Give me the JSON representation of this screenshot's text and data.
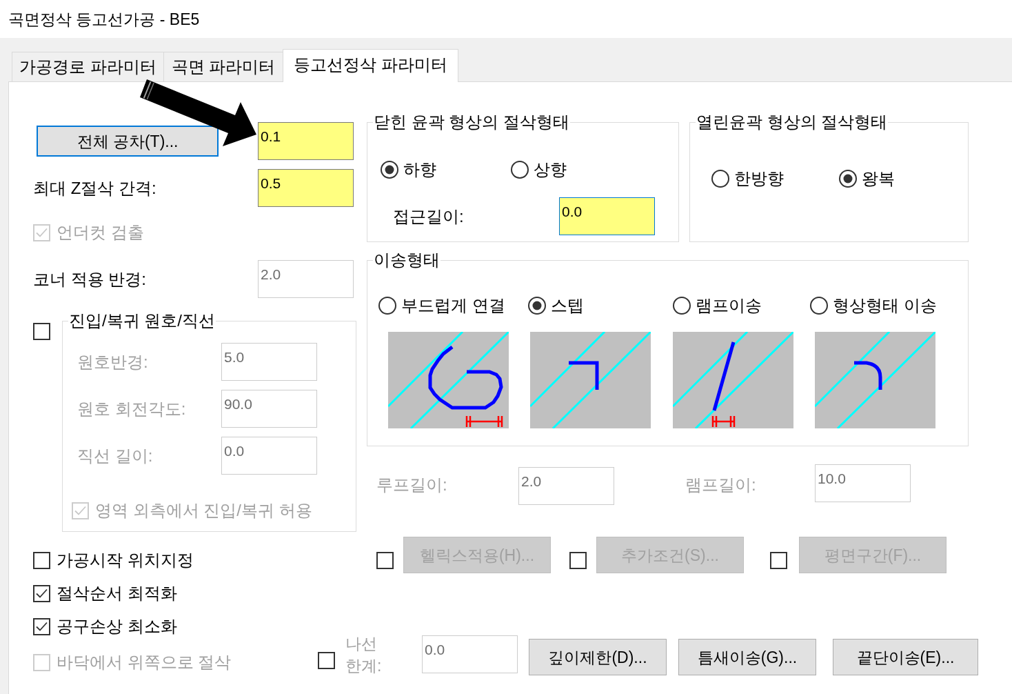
{
  "window": {
    "title": "곡면정삭 등고선가공 - BE5"
  },
  "tabs": [
    {
      "label": "가공경로 파라미터",
      "selected": false
    },
    {
      "label": "곡면 파라미터",
      "selected": false
    },
    {
      "label": "등고선정삭 파라미터",
      "selected": true
    }
  ],
  "tolerance": {
    "button": {
      "label": "전체 공차(T)...",
      "focused": true,
      "disabled": false
    },
    "field": {
      "value": "0.1",
      "highlighted": true
    }
  },
  "max_z_step": {
    "label": "최대 Z절삭 간격:",
    "disabled": false,
    "field": {
      "value": "0.5",
      "highlighted": true
    }
  },
  "undercut_check": {
    "label": "언더컷 검출",
    "checked": true,
    "disabled": true
  },
  "corner_radius": {
    "label": "코너 적용 반경:",
    "disabled": false,
    "field": {
      "value": "2.0",
      "disabled": true
    }
  },
  "entry_exit": {
    "checked": false,
    "title": "진입/복귀 원호/직선",
    "rows": [
      {
        "label": "원호반경:",
        "disabled": true,
        "field": {
          "value": "5.0",
          "disabled": true
        }
      },
      {
        "label": "원호 회전각도:",
        "disabled": true,
        "field": {
          "value": "90.0",
          "disabled": true
        }
      },
      {
        "label": "직선 길이:",
        "disabled": true,
        "field": {
          "value": "0.0",
          "disabled": true
        }
      }
    ],
    "outside_check": {
      "label": "영역 외측에서 진입/복귀 허용",
      "checked": true,
      "disabled": true
    }
  },
  "options": [
    {
      "label": "가공시작 위치지정",
      "checked": false,
      "disabled": false
    },
    {
      "label": "절삭순서 최적화",
      "checked": true,
      "disabled": false
    },
    {
      "label": "공구손상 최소화",
      "checked": true,
      "disabled": false
    }
  ],
  "closed_contour": {
    "title": "닫힌 윤곽 형상의 절삭형태",
    "radios": [
      {
        "label": "하향",
        "selected": true
      },
      {
        "label": "상향",
        "selected": false
      }
    ],
    "approach": {
      "label": "접근길이:",
      "disabled": false,
      "field": {
        "value": "0.0",
        "highlighted": true,
        "focused": true
      }
    }
  },
  "open_contour": {
    "title": "열린윤곽 형상의 절삭형태",
    "radios": [
      {
        "label": "한방향",
        "selected": false
      },
      {
        "label": "왕복",
        "selected": true
      }
    ]
  },
  "link_type": {
    "title": "이송형태",
    "options": [
      {
        "label": "부드럽게 연결",
        "selected": false,
        "kind": "smooth"
      },
      {
        "label": "스텝",
        "selected": true,
        "kind": "step"
      },
      {
        "label": "램프이송",
        "selected": false,
        "kind": "ramp"
      },
      {
        "label": "형상형태 이송",
        "selected": false,
        "kind": "profile"
      }
    ]
  },
  "lengths": [
    {
      "label": "루프길이:",
      "disabled": true,
      "field": {
        "value": "2.0",
        "disabled": true
      }
    },
    {
      "label": "램프길이:",
      "disabled": true,
      "field": {
        "value": "10.0",
        "disabled": true
      }
    }
  ],
  "extras": [
    {
      "checked": false,
      "button": {
        "label": "헬릭스적용(H)...",
        "disabled": true
      }
    },
    {
      "checked": false,
      "button": {
        "label": "추가조건(S)...",
        "disabled": true
      }
    },
    {
      "checked": false,
      "button": {
        "label": "평면구간(F)...",
        "disabled": true
      }
    }
  ],
  "bottom_check": {
    "label": "바닥에서 위쪽으로 절삭",
    "checked": false,
    "disabled": true
  },
  "spiral": {
    "checked": false,
    "label": "나선 한계:",
    "disabled": true,
    "field": {
      "value": "0.0",
      "disabled": true
    }
  },
  "bottom_buttons": [
    {
      "label": "깊이제한(D)...",
      "disabled": false
    },
    {
      "label": "틈새이송(G)...",
      "disabled": false
    },
    {
      "label": "끝단이송(E)...",
      "disabled": false
    }
  ]
}
